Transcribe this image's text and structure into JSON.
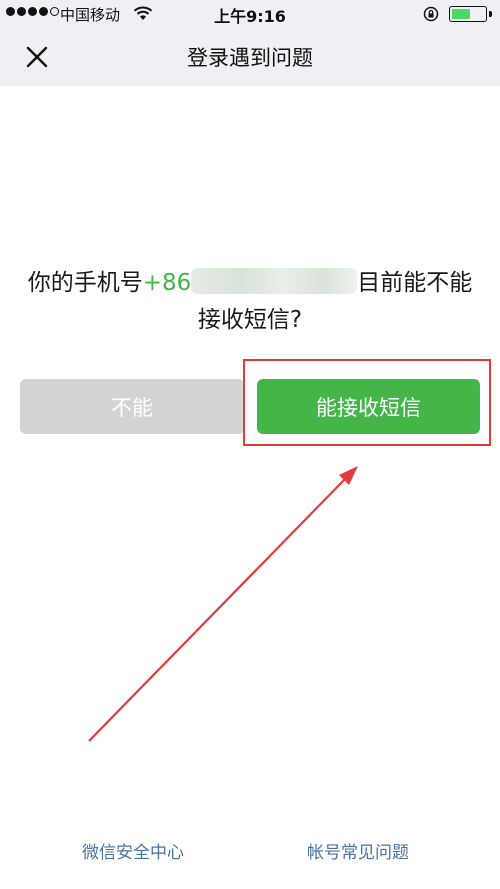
{
  "status_bar": {
    "carrier": "中国移动",
    "time": "上午9:16",
    "battery_level": 0.55,
    "icons": [
      "signal-dots",
      "wifi-icon",
      "orientation-lock-icon",
      "battery-icon"
    ]
  },
  "nav": {
    "title": "登录遇到问题",
    "close_icon": "close-icon"
  },
  "question": {
    "prefix": "你的手机号",
    "country_code": "+86",
    "suffix": "目前能不能接收短信?"
  },
  "buttons": {
    "no_label": "不能",
    "yes_label": "能接收短信"
  },
  "footer": {
    "left_link": "微信安全中心",
    "right_link": "帐号常见问题"
  },
  "colors": {
    "accent_green": "#44b549",
    "disabled_gray": "#d3d3d3",
    "link_blue": "#4a73a3",
    "annotation_red": "#e33b3b",
    "bar_background": "#efeff4"
  }
}
